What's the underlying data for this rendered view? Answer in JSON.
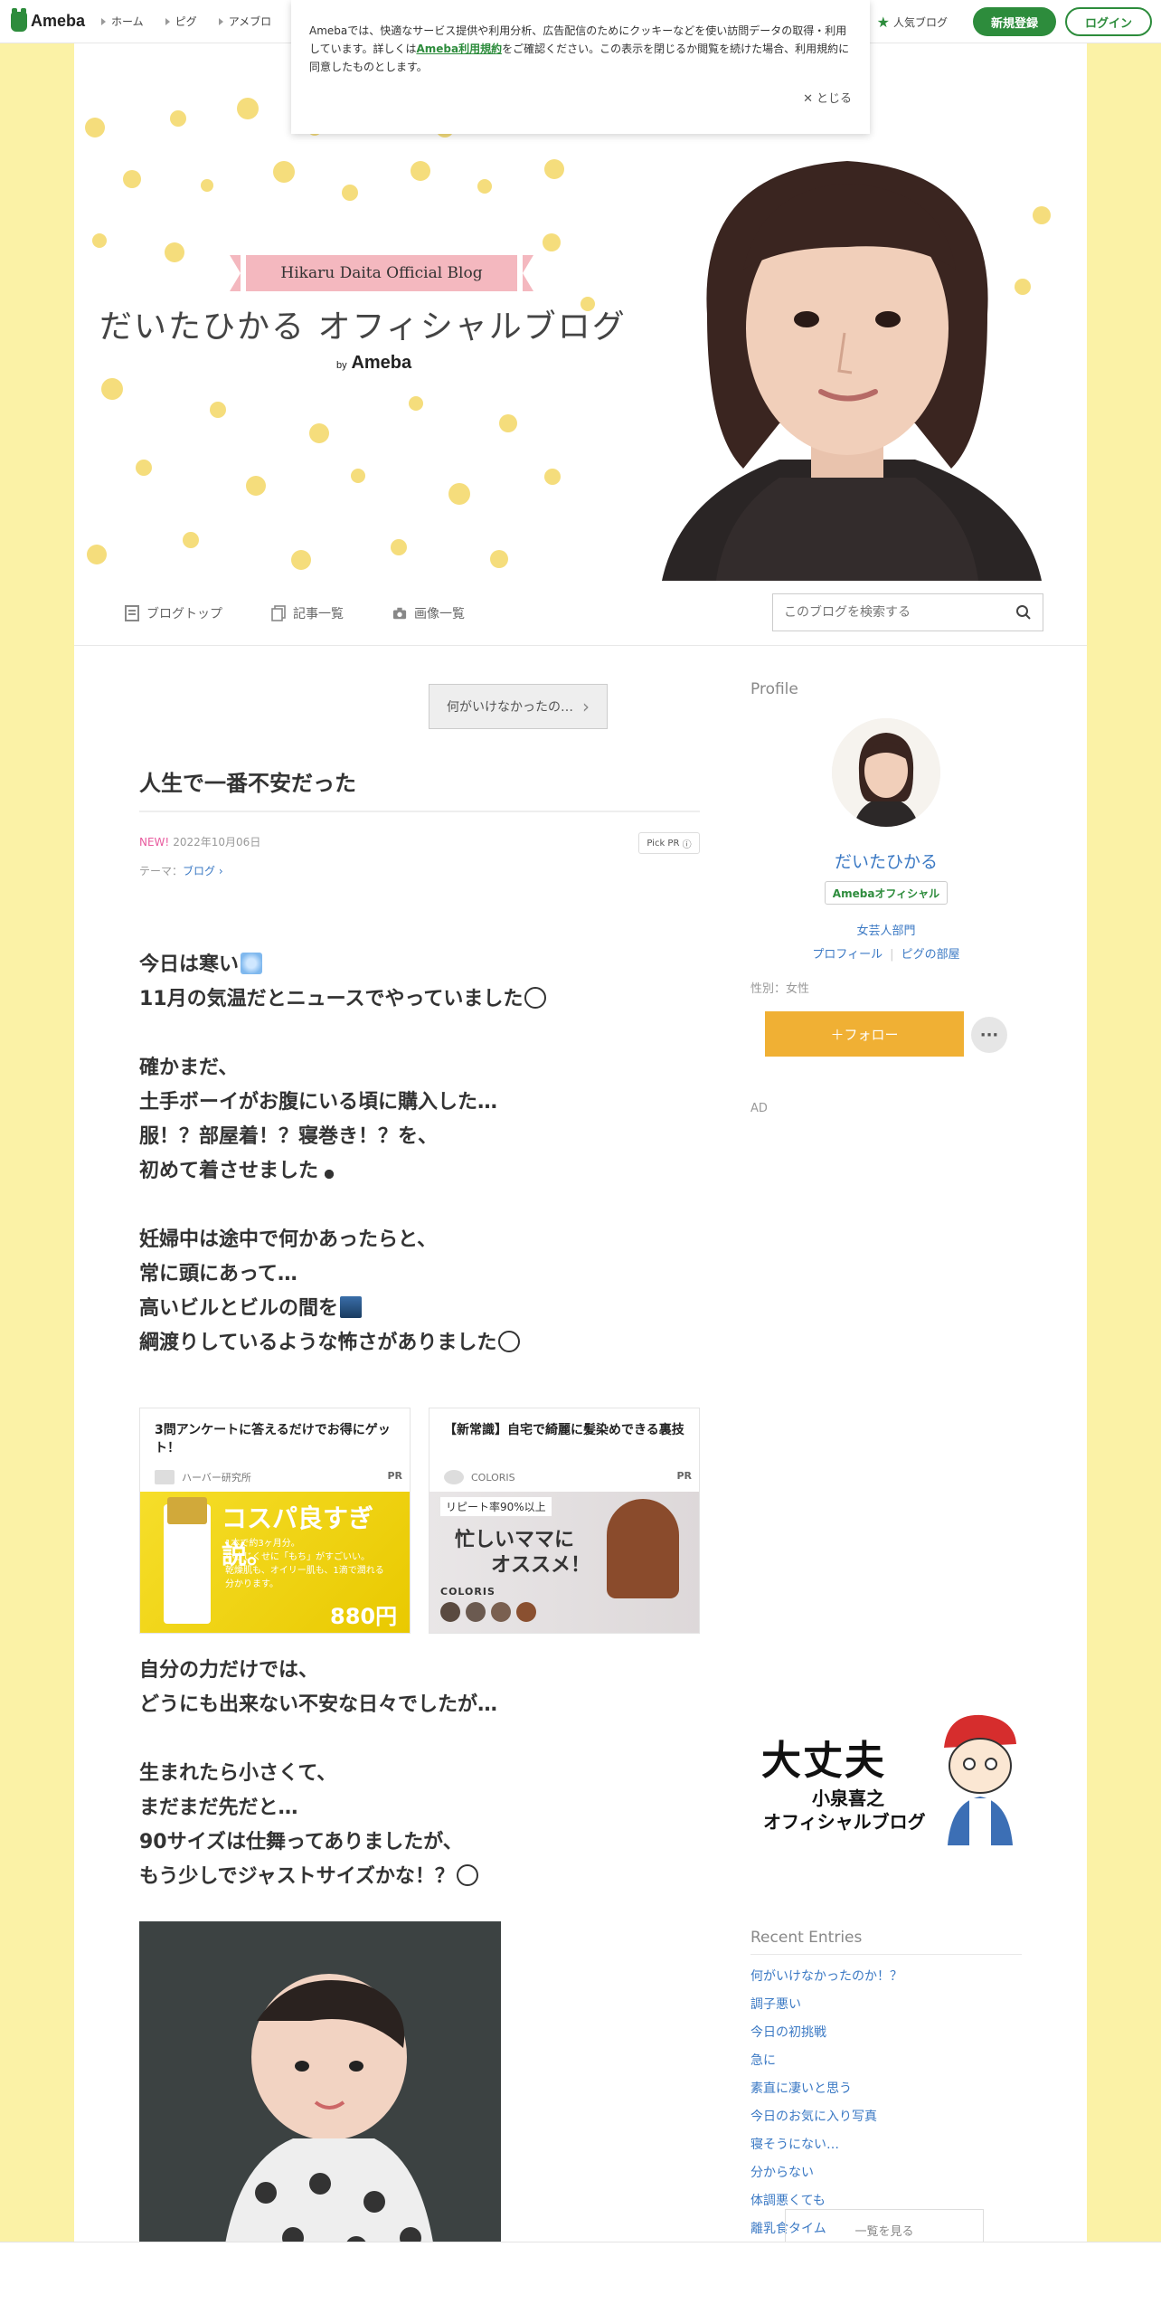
{
  "topbar": {
    "logo_text": "Ameba",
    "links": [
      "ホーム",
      "ピグ",
      "アメブロ"
    ],
    "popular_label": "人気ブログ",
    "register_label": "新規登録",
    "login_label": "ログイン"
  },
  "cookie": {
    "text_before": "Amebaでは、快適なサービス提供や利用分析、広告配信のためにクッキーなどを使い訪問データの取得・利用しています。詳しくは",
    "link": "Ameba利用規約",
    "text_after": "をご確認ください。この表示を閉じるか閲覧を続けた場合、利用規約に同意したものとします。",
    "close_label": "とじる"
  },
  "header": {
    "ribbon": "Hikaru Daita Official Blog",
    "title": "だいたひかる オフィシャルブログ",
    "by": "by",
    "brand": "Ameba"
  },
  "blog_nav": {
    "items": [
      "ブログトップ",
      "記事一覧",
      "画像一覧"
    ],
    "search_placeholder": "このブログを検索する"
  },
  "article": {
    "prev_label": "何がいけなかったの…",
    "title": "人生で一番不安だった",
    "new_label": "NEW!",
    "date": "2022年10月06日",
    "pickpr": "Pick PR",
    "theme_label": "テーマ：",
    "theme": "ブログ",
    "p1": [
      "今日は寒い",
      "11月の気温だとニュースでやっていました"
    ],
    "p2": [
      "確かまだ、",
      "土手ボーイがお腹にいる頃に購入した…",
      "服！？部屋着！？寝巻き！？を、",
      "初めて着させました"
    ],
    "p3": [
      "妊婦中は途中で何かあったらと、",
      "常に頭にあって…",
      "高いビルとビルの間を",
      "綱渡りしているような怖さがありました"
    ],
    "p4": [
      "自分の力だけでは、",
      "どうにも出来ない不安な日々でしたが…"
    ],
    "p5": [
      "生まれたら小さくて、",
      "まだまだ先だと…",
      "90サイズは仕舞ってありましたが、",
      "もう少しでジャストサイズかな！？"
    ]
  },
  "ads": [
    {
      "title": "3問アンケートに答えるだけでお得にゲット！",
      "source": "ハーバー研究所",
      "pr": "PR",
      "headline": "コスパ良すぎ説。",
      "sub": [
        "1本で約3ヶ月分。",
        "小さじくせに「もち」がすごいい。",
        "乾燥肌も、オイリー肌も、1滴で潤れる",
        "分かります。"
      ],
      "price": "880円"
    },
    {
      "title": "【新常識】自宅で綺麗に髪染めできる裏技",
      "source": "COLORIS",
      "pr": "PR",
      "tag": "リピート率90%以上",
      "headline": [
        "忙しいママに",
        "オススメ！"
      ],
      "brand": "COLORIS"
    }
  ],
  "sidebar": {
    "profile_heading": "Profile",
    "name": "だいたひかる",
    "badge": "Amebaオフィシャル",
    "genre": "女芸人部門",
    "profile_link": "プロフィール",
    "pig_link": "ピグの部屋",
    "gender": "性別：女性",
    "follow_label": "＋フォロー",
    "more_label": "···",
    "ad_label": "AD",
    "banner": {
      "line1": "大丈夫",
      "line2": "小泉喜之",
      "line3": "オフィシャルブログ"
    },
    "recent_heading": "Recent Entries",
    "recent": [
      "何がいけなかったのか！？",
      "調子悪い",
      "今日の初挑戦",
      "急に",
      "素直に凄いと思う",
      "今日のお気に入り写真",
      "寝そうにない…",
      "分からない",
      "体調悪くても",
      "離乳食タイム"
    ],
    "see_all": "一覧を見る"
  }
}
